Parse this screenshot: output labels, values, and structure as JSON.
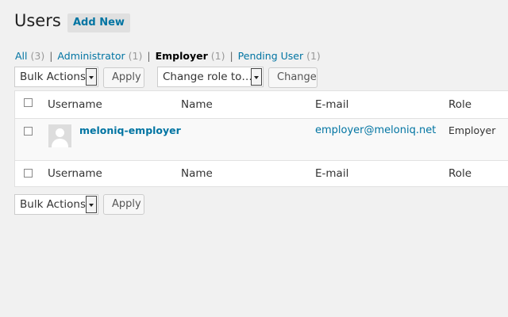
{
  "header": {
    "title": "Users",
    "add_new_label": "Add New"
  },
  "filters": {
    "all_label": "All",
    "all_count": "(3)",
    "admin_label": "Administrator",
    "admin_count": "(1)",
    "employer_label": "Employer",
    "employer_count": "(1)",
    "pending_label": "Pending User",
    "pending_count": "(1)",
    "separator": "|"
  },
  "top_actions": {
    "bulk_actions_value": "Bulk Actions",
    "apply_label": "Apply",
    "change_role_value": "Change role to…",
    "change_label": "Change"
  },
  "table": {
    "columns": {
      "username": "Username",
      "name": "Name",
      "email": "E-mail",
      "role": "Role"
    },
    "rows": [
      {
        "username": "meloniq-employer",
        "name": "",
        "email": "employer@meloniq.net",
        "role": "Employer"
      }
    ]
  },
  "bottom_actions": {
    "bulk_actions_value": "Bulk Actions",
    "apply_label": "Apply"
  },
  "colors": {
    "link": "#0074a2",
    "background": "#f1f1f1"
  }
}
